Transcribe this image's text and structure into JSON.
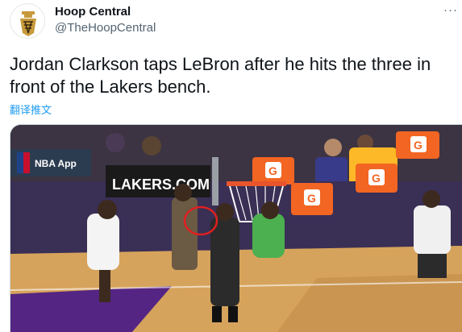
{
  "tweet": {
    "display_name": "Hoop Central",
    "handle": "@TheHoopCentral",
    "text": "Jordan Clarkson taps LeBron after he hits the three in front of the Lakers bench.",
    "translate_label": "翻译推文",
    "more_icon": "more-options-icon"
  },
  "media": {
    "banner_text": "LAKERS.COM",
    "cooler_label": "G",
    "nba_logo_text": "NBA App",
    "colors": {
      "lakers_purple": "#552583",
      "lakers_gold": "#fdb927",
      "gatorade_orange": "#f26522",
      "court_wood": "#d6a35c",
      "annotation_circle": "#e02020"
    }
  }
}
